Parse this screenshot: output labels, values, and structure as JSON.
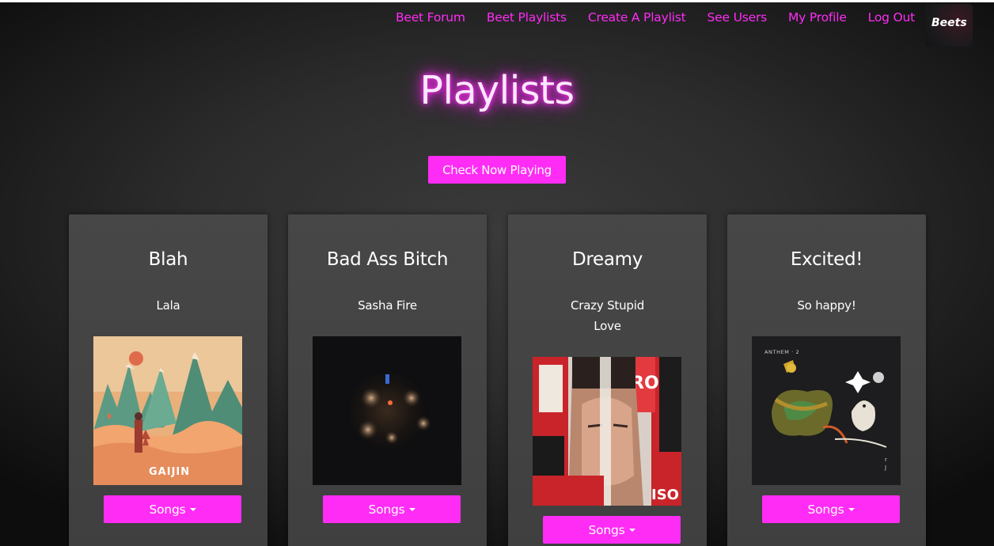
{
  "nav": {
    "items": [
      "Beet Forum",
      "Beet Playlists",
      "Create A Playlist",
      "See Users",
      "My Profile",
      "Log Out"
    ],
    "logo_text": "Beets"
  },
  "page": {
    "title": "Playlists",
    "now_playing_label": "Check Now Playing"
  },
  "playlists": [
    {
      "title": "Blah",
      "description": "Lala",
      "art_icon": "album-art-gaijin",
      "songs_label": "Songs"
    },
    {
      "title": "Bad Ass Bitch",
      "description": "Sasha Fire",
      "art_icon": "album-art-dark-orbs",
      "songs_label": "Songs"
    },
    {
      "title": "Dreamy",
      "description": "Crazy Stupid Love",
      "art_icon": "album-art-torn-poster",
      "songs_label": "Songs"
    },
    {
      "title": "Excited!",
      "description": "So happy!",
      "art_icon": "album-art-anthem",
      "songs_label": "Songs"
    }
  ],
  "album_art_text": {
    "gaijin": "GAIJIN",
    "anthem": "ANTHEM · 2"
  },
  "colors": {
    "accent": "#ff2cf5",
    "card": "#474747",
    "background": "#2c2c2c"
  }
}
